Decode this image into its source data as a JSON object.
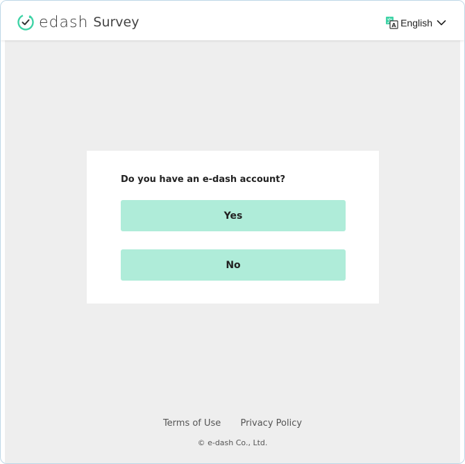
{
  "header": {
    "brand_name": "edash",
    "brand_suffix": "Survey",
    "language_label": "English",
    "icons": {
      "logo": "edash-logo-icon",
      "translate": "translate-icon",
      "dropdown": "chevron-down-icon"
    }
  },
  "survey": {
    "question": "Do you have an e-dash account?",
    "options": [
      {
        "label": "Yes"
      },
      {
        "label": "No"
      }
    ]
  },
  "footer": {
    "terms_label": "Terms of Use",
    "privacy_label": "Privacy Policy",
    "copyright": "© e-dash Co., Ltd."
  },
  "colors": {
    "accent": "#3fd3a6",
    "button_bg": "#afecd9",
    "page_bg": "#eeeeee",
    "card_bg": "#ffffff"
  }
}
